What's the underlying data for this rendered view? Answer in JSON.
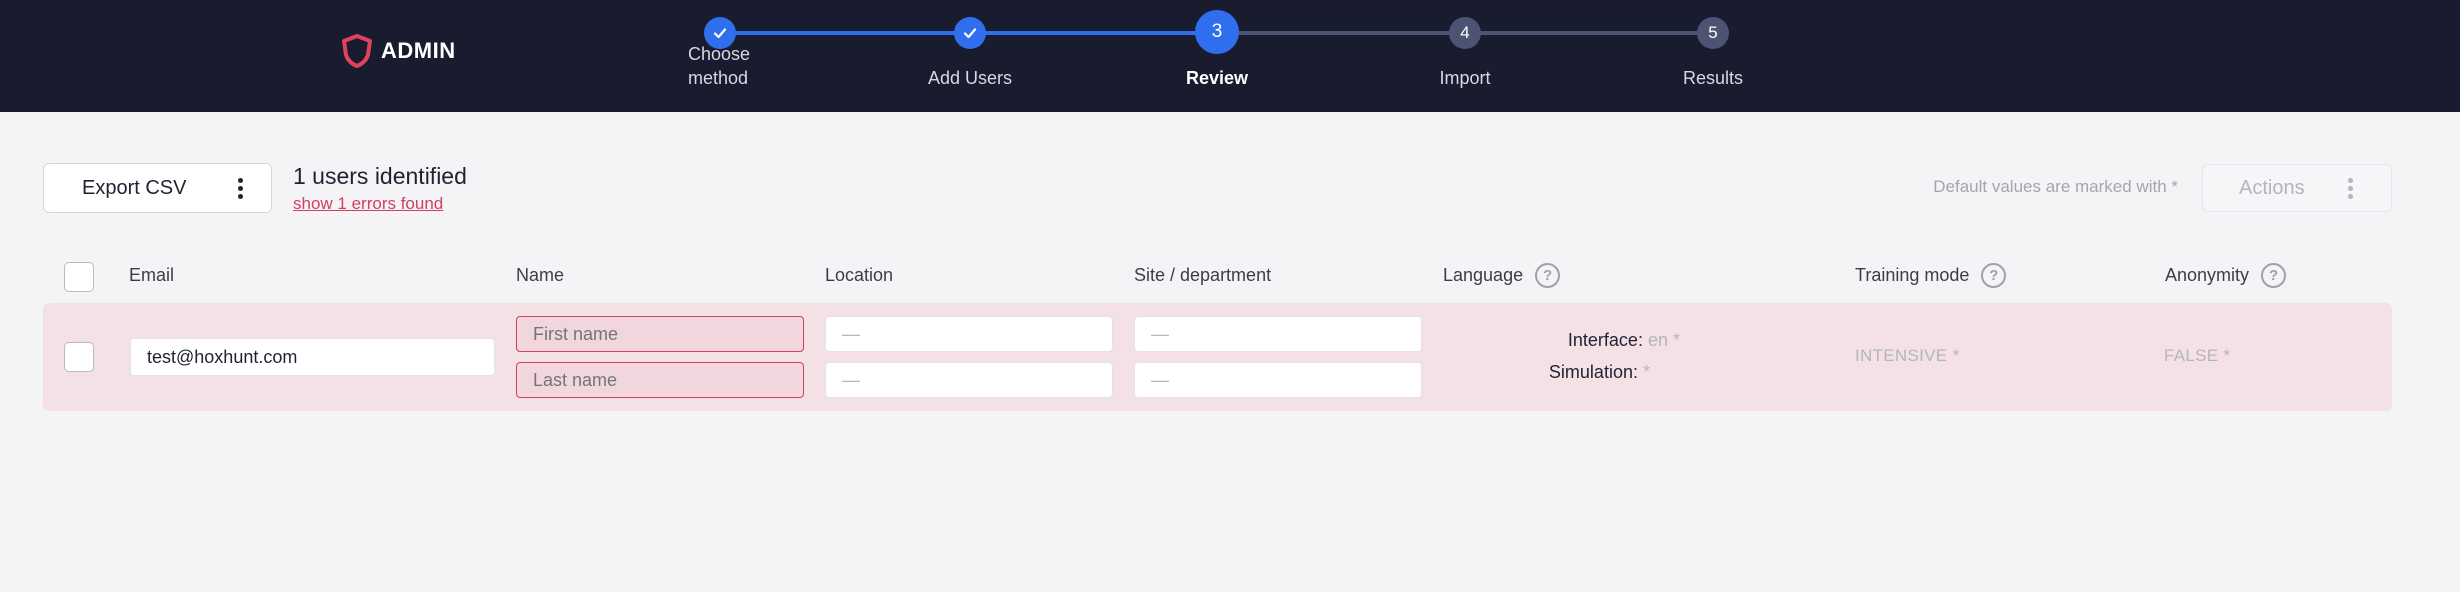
{
  "header": {
    "logo_text": "ADMIN",
    "colors": {
      "background": "#191b2e",
      "accent": "#2f6fed",
      "pending": "#4d5473",
      "logo": "#e0425f"
    },
    "steps": [
      {
        "number": "1",
        "label": "Choose method",
        "label_line1": "Choose",
        "label_line2": "method",
        "state": "done",
        "icon": "check-icon"
      },
      {
        "number": "2",
        "label": "Add Users",
        "state": "done",
        "icon": "check-icon"
      },
      {
        "number": "3",
        "label": "Review",
        "state": "active"
      },
      {
        "number": "4",
        "label": "Import",
        "state": "pending"
      },
      {
        "number": "5",
        "label": "Results",
        "state": "pending"
      }
    ]
  },
  "toolbar": {
    "export_label": "Export CSV",
    "users_identified": "1 users identified",
    "errors_link": "show 1 errors found",
    "defaults_note": "Default values are marked with *",
    "actions_label": "Actions"
  },
  "table": {
    "columns": {
      "email": "Email",
      "name": "Name",
      "location": "Location",
      "site": "Site / department",
      "language": "Language",
      "training_mode": "Training mode",
      "anonymity": "Anonymity"
    },
    "help_glyph": "?",
    "rows": [
      {
        "email": "test@hoxhunt.com",
        "first_name_placeholder": "First name",
        "last_name_placeholder": "Last name",
        "location_1": "—",
        "location_2": "—",
        "site_1": "—",
        "site_2": "—",
        "interface_label": "Interface:",
        "interface_value": "en *",
        "simulation_label": "Simulation:",
        "simulation_value": "*",
        "training_mode": "INTENSIVE *",
        "anonymity": "FALSE *"
      }
    ]
  }
}
